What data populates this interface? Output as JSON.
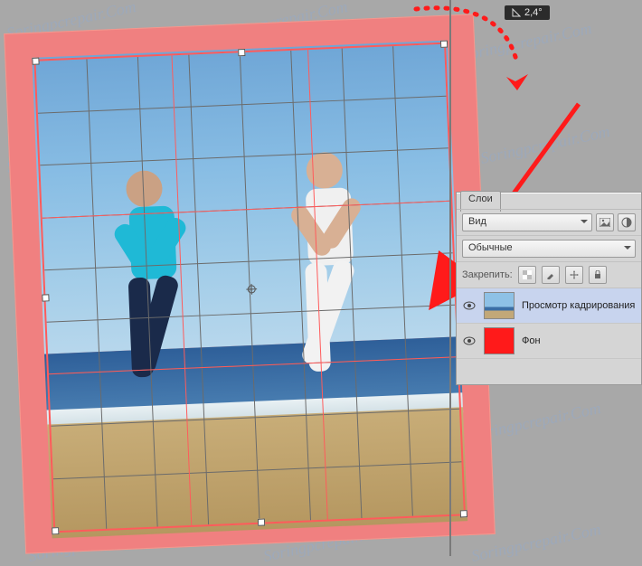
{
  "angle_tooltip": {
    "prefix": "⊿ :",
    "value": "2,4°"
  },
  "watermark_text": "Soringpcrepair.Com",
  "panel": {
    "tab_label": "Слои",
    "view_label": "Вид",
    "blend_mode_selected": "Обычные",
    "lock_label": "Закрепить:",
    "layers": [
      {
        "name": "Просмотр кадрирования",
        "selected": true,
        "thumb": "img",
        "visible": true
      },
      {
        "name": "Фон",
        "selected": false,
        "thumb": "red",
        "visible": true
      }
    ]
  },
  "colors": {
    "salmon": "#f08080",
    "crop_red": "#ff5b5b",
    "panel_bg": "#d5d5d5"
  }
}
